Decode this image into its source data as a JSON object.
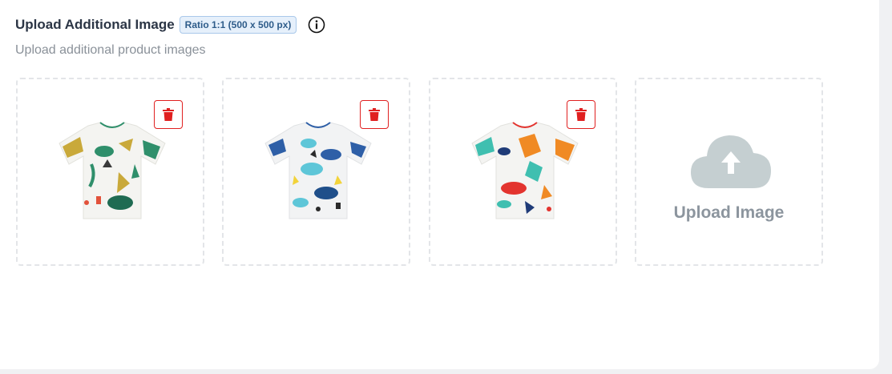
{
  "section": {
    "title": "Upload Additional Image",
    "ratio_badge": "Ratio 1:1 (500 x 500 px)",
    "info_icon": "info-circle-icon",
    "subtitle": "Upload additional product images"
  },
  "images": [
    {
      "name": "dinosaur-tshirt-1",
      "palette": [
        "#c9a93a",
        "#2f8f6b",
        "#e2523b",
        "#3a3a3a"
      ]
    },
    {
      "name": "dinosaur-tshirt-2",
      "palette": [
        "#2e5fa7",
        "#5ec6d8",
        "#f2d33a",
        "#2b2b2b"
      ]
    },
    {
      "name": "dinosaur-tshirt-3",
      "palette": [
        "#f08a24",
        "#3fbfb0",
        "#e3342f",
        "#1f3b78"
      ]
    }
  ],
  "delete_icon": "trash-icon",
  "upload": {
    "label": "Upload Image",
    "icon": "cloud-upload-icon"
  },
  "colors": {
    "delete_red": "#e02020",
    "cloud_gray": "#c5cfd1",
    "badge_bg": "#e6f0fb",
    "badge_text": "#2e5c8a"
  }
}
